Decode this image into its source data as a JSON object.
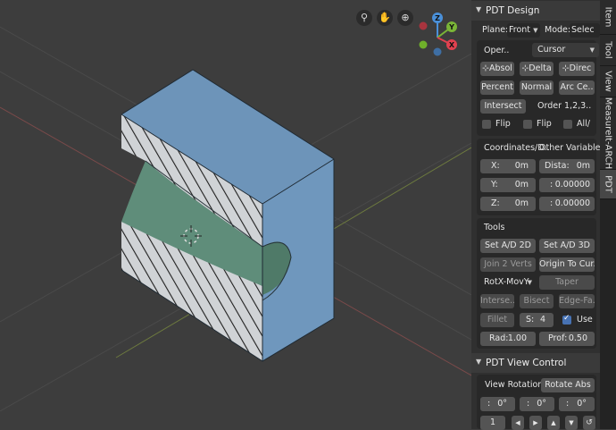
{
  "viewport": {
    "tool_icons": [
      "camera-icon",
      "hand-icon",
      "zoom-icon"
    ],
    "gizmo": {
      "z": "Z",
      "y": "Y",
      "x": "X"
    }
  },
  "tabs": [
    "Item",
    "Tool",
    "View",
    "MeasureIt-ARCH",
    "PDT"
  ],
  "pdt_design": {
    "title": "PDT Design",
    "plane_label": "Plane:",
    "plane_value": "Front",
    "mode_label": "Mode:",
    "mode_value": "Selec",
    "oper_label": "Oper..",
    "oper_value": "Cursor",
    "absol": "Absol",
    "delta": "Delta",
    "direc": "Direc",
    "percent": "Percent",
    "normal": "Normal",
    "arc_centre": "Arc Ce..",
    "intersect": "Intersect",
    "order_label": "Order",
    "order_value": "1,2,3..",
    "flip1": "Flip",
    "flip2": "Flip",
    "all": "All/",
    "coords_tab": "Coordinates/D..",
    "other_tab": "Other Variables",
    "x_label": "X:",
    "x_value": "0m",
    "dista_label": "Dista:",
    "dista_value": "0m",
    "y_label": "Y:",
    "y_value": "0m",
    "y_right_label": ":",
    "y_right_value": "0.00000",
    "z_label": "Z:",
    "z_value": "0m",
    "z_right_label": ":",
    "z_right_value": "0.00000",
    "tools_title": "Tools",
    "set_ad_2d": "Set A/D 2D",
    "set_ad_3d": "Set A/D 3D",
    "join_2_verts": "Join 2 Verts",
    "origin_to_cursor": "Origin To Cur..",
    "rot_value": "RotX-MovY",
    "taper": "Taper",
    "interse": "Interse..",
    "bisect": "Bisect",
    "edge_fa": "Edge-Fa..",
    "fillet": "Fillet",
    "s_label": "S:",
    "s_value": "4",
    "use": "Use",
    "rad_label": "Rad:",
    "rad_value": "1.00",
    "prof_label": "Prof:",
    "prof_value": "0.50"
  },
  "pdt_view": {
    "title": "PDT View Control",
    "view_rotation": "View Rotation",
    "rotate_abs": "Rotate Abs",
    "rot1_label": ":",
    "rot1_value": "0°",
    "rot2_label": ":",
    "rot2_value": "0°",
    "rot3_label": ":",
    "rot3_value": "0°",
    "step_value": "1"
  },
  "colors": {
    "viewport_bg": "#3d3d3d",
    "object_blue": "#6b93b8",
    "object_face": "#cfd3d6",
    "curved_green": "#5f8d7a",
    "panel_bg": "#303030",
    "accent": "#4772b3"
  }
}
